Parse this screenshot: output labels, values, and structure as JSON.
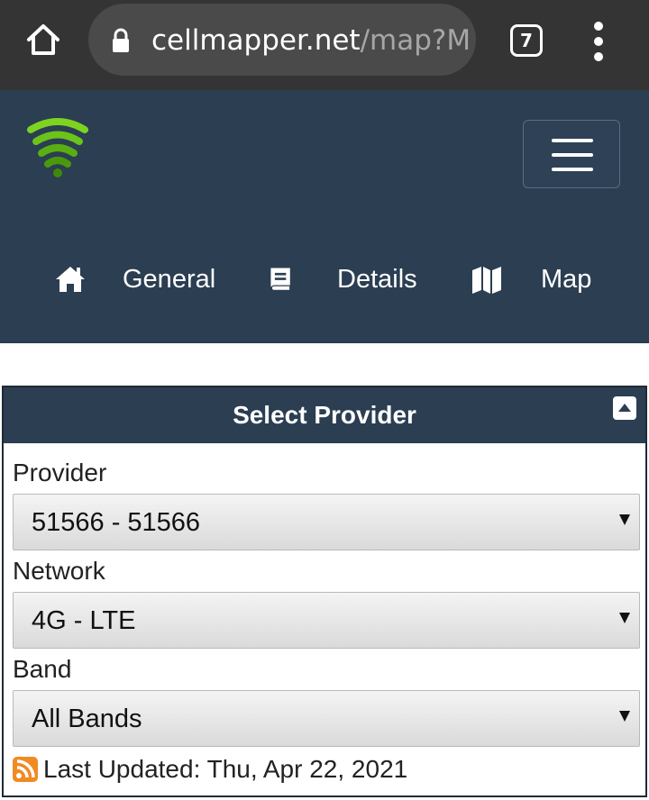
{
  "browser": {
    "url_host": "cellmapper.net",
    "url_path": "/map?M",
    "tab_count": "7"
  },
  "colors": {
    "navbar": "#2b3e52",
    "chrome": "#343434",
    "logo_green": "#7ed321"
  },
  "nav": {
    "items": [
      {
        "label": "General",
        "icon": "home-icon"
      },
      {
        "label": "Details",
        "icon": "book-icon"
      },
      {
        "label": "Map",
        "icon": "map-icon"
      }
    ]
  },
  "panel": {
    "title": "Select Provider",
    "fields": [
      {
        "label": "Provider",
        "value": "51566 - 51566"
      },
      {
        "label": "Network",
        "value": "4G - LTE"
      },
      {
        "label": "Band",
        "value": "All Bands"
      }
    ],
    "last_updated": "Last Updated: Thu, Apr 22, 2021"
  }
}
